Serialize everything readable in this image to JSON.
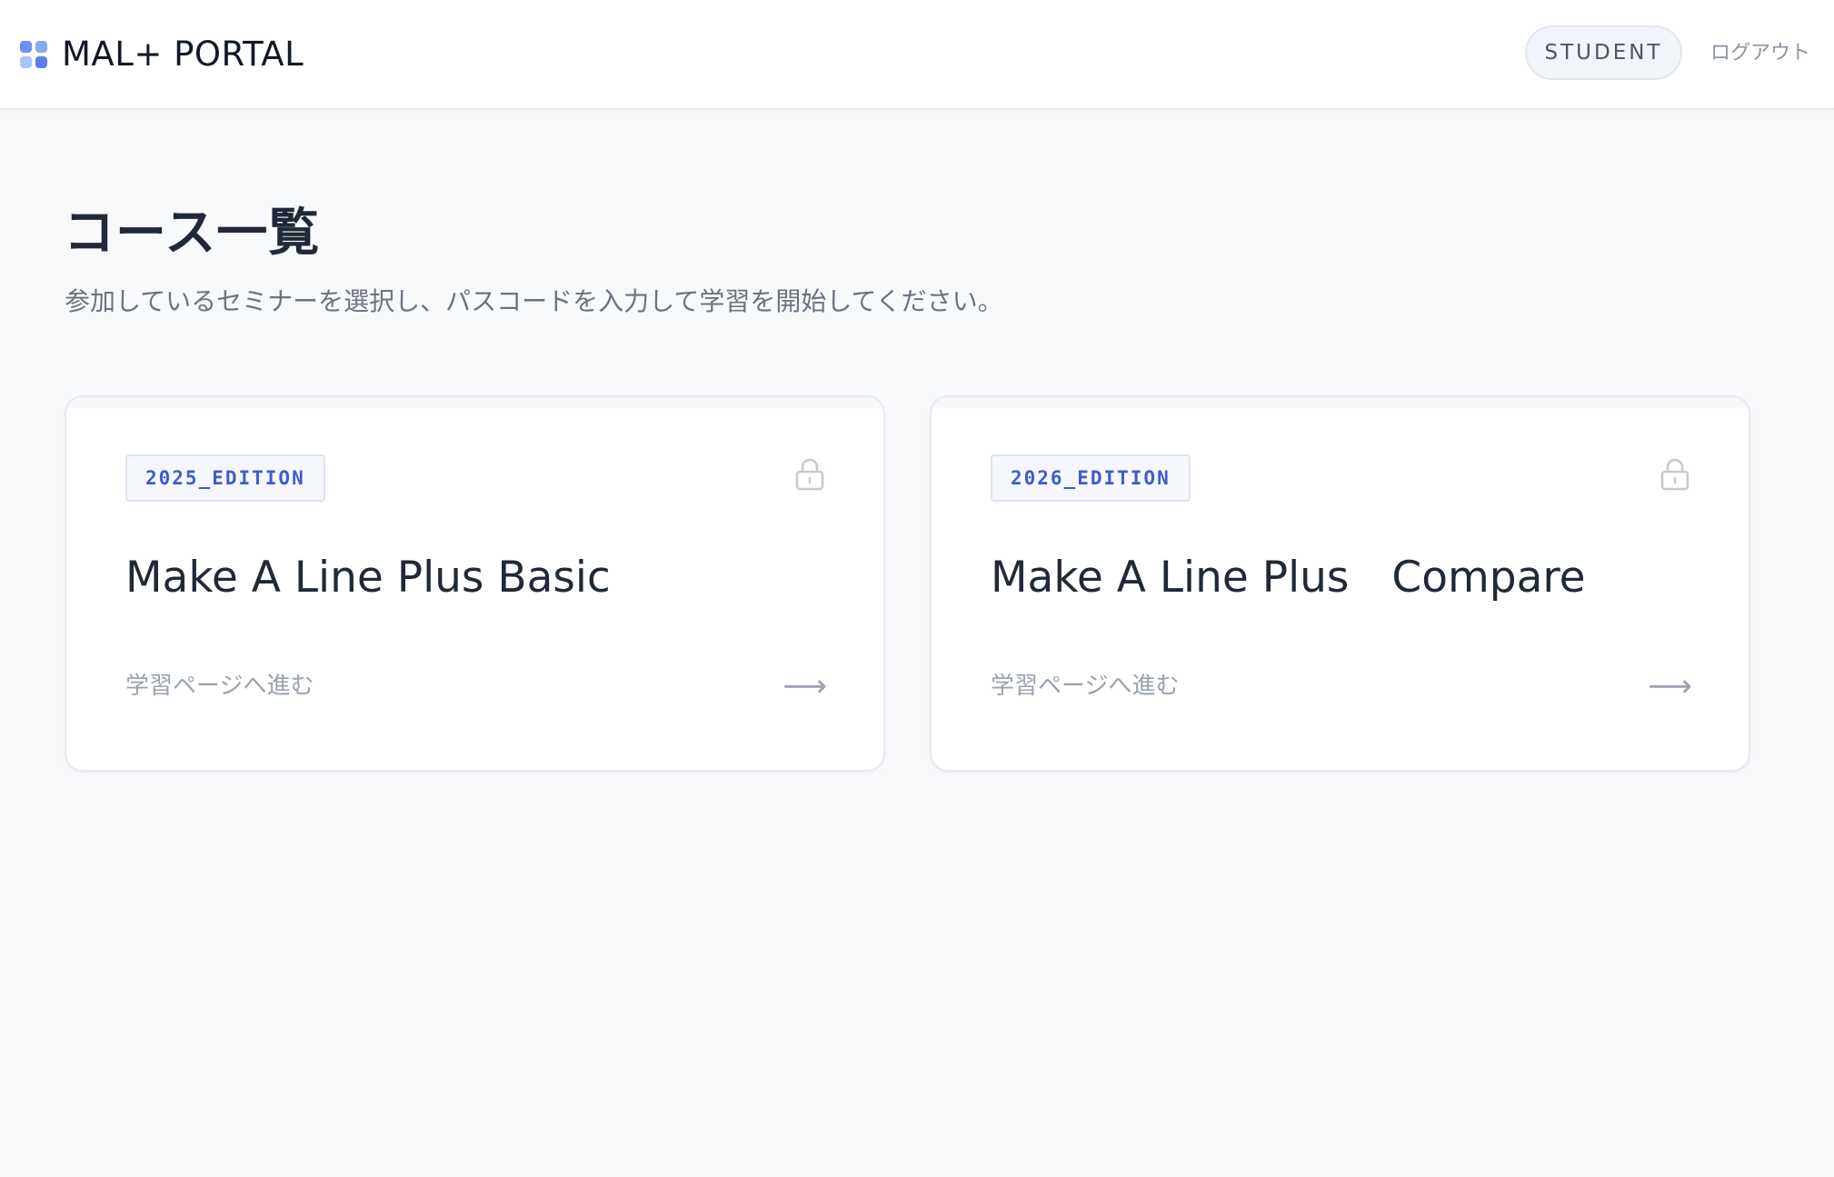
{
  "header": {
    "app_title": "MAL+ PORTAL",
    "role_badge": "STUDENT",
    "logout_label": "ログアウト"
  },
  "main": {
    "title": "コース一覧",
    "subtitle": "参加しているセミナーを選択し、パスコードを入力して学習を開始してください。",
    "courses": [
      {
        "edition": "2025_EDITION",
        "title": "Make A Line Plus Basic",
        "action_label": "学習ページへ進む",
        "locked": true
      },
      {
        "edition": "2026_EDITION",
        "title": "Make A Line Plus　Compare",
        "action_label": "学習ページへ進む",
        "locked": true
      }
    ]
  },
  "icons": {
    "logo": "grid-logo-icon",
    "lock": "lock-icon",
    "arrow": "arrow-right-icon"
  },
  "colors": {
    "accent": "#3f5bd0",
    "logo": "#6d8ff0",
    "background": "#f8f9fb"
  }
}
